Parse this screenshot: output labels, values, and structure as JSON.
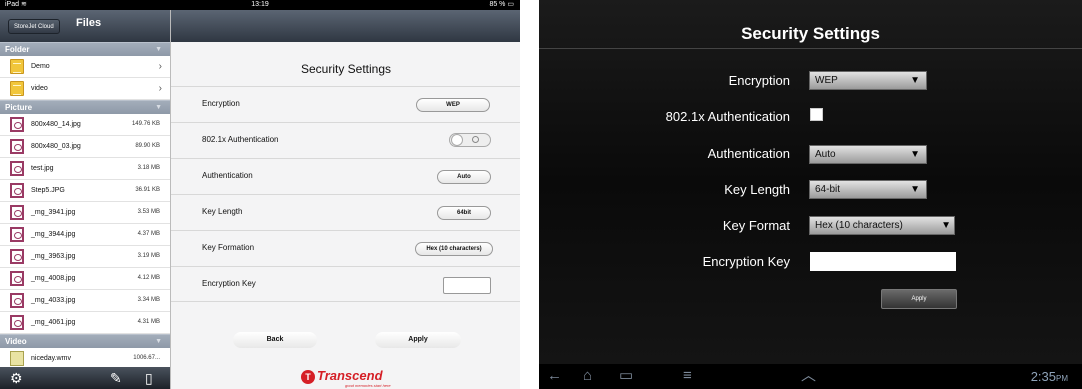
{
  "ipad": {
    "status": {
      "carrier": "iPad",
      "time": "13:19",
      "battery": "85 %"
    },
    "cloud_button": "StoreJet Cloud",
    "files_title": "Files",
    "sections": {
      "folder": "Folder",
      "picture": "Picture",
      "video": "Video"
    },
    "folders": [
      {
        "name": "Demo"
      },
      {
        "name": "video"
      }
    ],
    "pictures": [
      {
        "name": "800x480_14.jpg",
        "size": "149.76 KB"
      },
      {
        "name": "800x480_03.jpg",
        "size": "89.90 KB"
      },
      {
        "name": "test.jpg",
        "size": "3.18 MB"
      },
      {
        "name": "Step5.JPG",
        "size": "36.91 KB"
      },
      {
        "name": "_mg_3941.jpg",
        "size": "3.53 MB"
      },
      {
        "name": "_mg_3944.jpg",
        "size": "4.37 MB"
      },
      {
        "name": "_mg_3963.jpg",
        "size": "3.19 MB"
      },
      {
        "name": "_mg_4008.jpg",
        "size": "4.12 MB"
      },
      {
        "name": "_mg_4033.jpg",
        "size": "3.34 MB"
      },
      {
        "name": "_mg_4061.jpg",
        "size": "4.31 MB"
      }
    ],
    "videos": [
      {
        "name": "niceday.wmv",
        "size": "1006.67..."
      }
    ],
    "settings": {
      "title": "Security Settings",
      "encryption_label": "Encryption",
      "encryption_value": "WEP",
      "auth8021x_label": "802.1x Authentication",
      "auth8021x_enabled": false,
      "authentication_label": "Authentication",
      "authentication_value": "Auto",
      "key_length_label": "Key Length",
      "key_length_value": "64bit",
      "key_formation_label": "Key Formation",
      "key_formation_value": "Hex (10 characters)",
      "encryption_key_label": "Encryption Key",
      "encryption_key_value": "",
      "back_label": "Back",
      "apply_label": "Apply"
    },
    "brand": {
      "name": "Transcend",
      "tagline": "good memories start here"
    }
  },
  "android": {
    "title": "Security Settings",
    "encryption_label": "Encryption",
    "encryption_value": "WEP",
    "auth8021x_label": "802.1x Authentication",
    "auth8021x_checked": false,
    "authentication_label": "Authentication",
    "authentication_value": "Auto",
    "key_length_label": "Key Length",
    "key_length_value": "64-bit",
    "key_format_label": "Key Format",
    "key_format_value": "Hex (10 characters)",
    "encryption_key_label": "Encryption Key",
    "encryption_key_value": "",
    "apply_label": "Apply",
    "clock": "2:35",
    "clock_suffix": "PM"
  },
  "icons": [
    "wifi-icon",
    "battery-icon",
    "folder-icon",
    "picture-icon",
    "video-icon",
    "chevron-right-icon",
    "gear-icon",
    "edit-icon",
    "phone-icon",
    "back-icon",
    "home-icon",
    "recent-apps-icon",
    "menu-icon",
    "chevron-up-icon"
  ]
}
